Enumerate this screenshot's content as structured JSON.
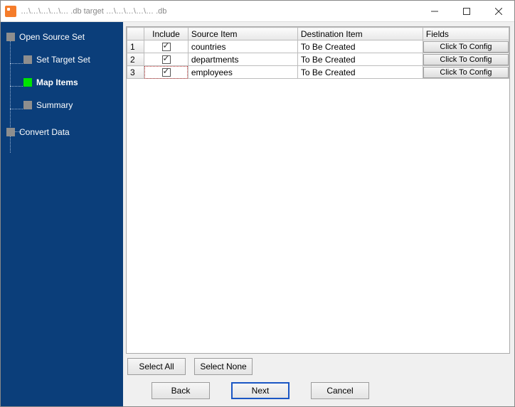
{
  "window": {
    "title": "…\\…\\…\\…\\… .db    target …\\…\\…\\…\\… .db"
  },
  "sidebar": {
    "items": [
      {
        "label": "Open Source Set",
        "active": false,
        "child": false
      },
      {
        "label": "Set Target Set",
        "active": false,
        "child": true
      },
      {
        "label": "Map Items",
        "active": true,
        "child": true
      },
      {
        "label": "Summary",
        "active": false,
        "child": true
      },
      {
        "label": "Convert Data",
        "active": false,
        "child": false
      }
    ]
  },
  "grid": {
    "headers": {
      "include": "Include",
      "source": "Source Item",
      "dest": "Destination Item",
      "fields": "Fields"
    },
    "fields_button_label": "Click To Config",
    "rows": [
      {
        "n": "1",
        "include": true,
        "source": "countries",
        "dest": "To Be Created"
      },
      {
        "n": "2",
        "include": true,
        "source": "departments",
        "dest": "To Be Created"
      },
      {
        "n": "3",
        "include": true,
        "source": "employees",
        "dest": "To Be Created"
      }
    ],
    "selected": {
      "row": 3,
      "col": "include"
    }
  },
  "buttons": {
    "select_all": "Select All",
    "select_none": "Select None",
    "back": "Back",
    "next": "Next",
    "cancel": "Cancel"
  }
}
